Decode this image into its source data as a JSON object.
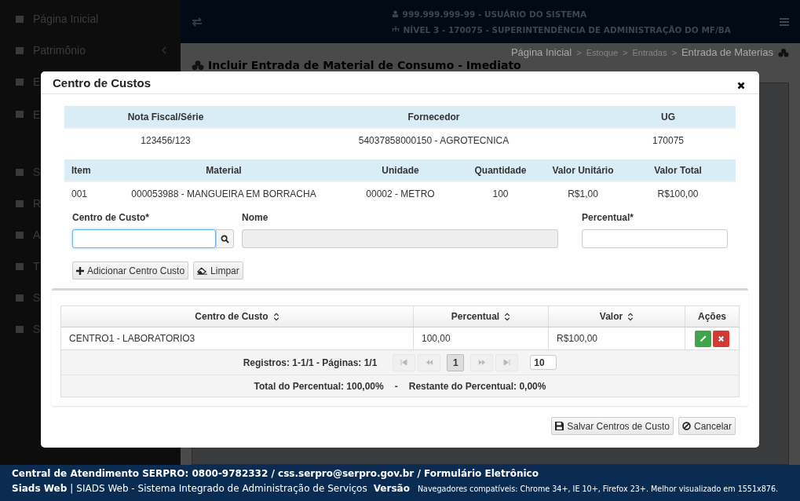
{
  "sidebar": {
    "items": [
      {
        "label": "Página Inicial",
        "has_chevron": false
      },
      {
        "label": "Patrimônio",
        "has_chevron": true
      },
      {
        "label": "E"
      },
      {
        "label": "E"
      },
      {
        "label": "S"
      },
      {
        "label": "R"
      },
      {
        "label": "A"
      },
      {
        "label": "T"
      },
      {
        "label": "S"
      },
      {
        "label": "S"
      }
    ]
  },
  "header": {
    "user": "999.999.999-99 - USUÁRIO DO SISTEMA",
    "level": "NÍVEL 3 - 170075 - SUPERINTENDÊNCIA DE ADMINISTRAÇÃO DO MF/BA"
  },
  "breadcrumb": {
    "separator": ">",
    "items": [
      {
        "label": "Página Inicial",
        "muted": false
      },
      {
        "label": "Estoque",
        "muted": true
      },
      {
        "label": "Entradas",
        "muted": true
      },
      {
        "label": "Entrada de Materias",
        "muted": false
      }
    ]
  },
  "page_title": "Incluir Entrada de Material de Consumo - Imediato",
  "modal": {
    "title": "Centro de Custos",
    "invoice": {
      "columns": [
        "Nota Fiscal/Série",
        "Fornecedor",
        "UG"
      ],
      "row": [
        "123456/123",
        "54037858000150 - AGROTECNICA",
        "170075"
      ]
    },
    "items": {
      "columns": [
        "Item",
        "Material",
        "Unidade",
        "Quantidade",
        "Valor Unitário",
        "Valor Total"
      ],
      "rows": [
        [
          "001",
          "000053988 - MANGUEIRA EM BORRACHA",
          "00002 - METRO",
          "100",
          "R$1,00",
          "R$100,00"
        ]
      ]
    },
    "form": {
      "fields": [
        {
          "kind": "search",
          "label": "Centro de Custo*",
          "focused": true,
          "disabled": false
        },
        {
          "kind": "text",
          "label": "Nome",
          "focused": false,
          "disabled": true
        },
        {
          "kind": "text",
          "label": "Percentual*",
          "focused": false,
          "disabled": false
        }
      ]
    },
    "form_buttons": [
      {
        "kind": "add",
        "label": "Adicionar Centro Custo"
      },
      {
        "kind": "clear",
        "label": "Limpar"
      }
    ],
    "cost_table": {
      "columns": [
        {
          "label": "Centro de Custo",
          "sortable": true
        },
        {
          "label": "Percentual",
          "sortable": true
        },
        {
          "label": "Valor",
          "sortable": true
        },
        {
          "label": "Ações",
          "sortable": false
        }
      ],
      "rows": [
        [
          "CENTRO1 - LABORATORIO3",
          "100,00",
          "R$100,00"
        ]
      ],
      "pagination": {
        "summary": "Registros: 1-1/1 - Páginas: 1/1",
        "nav_disabled": true,
        "pages": [
          {
            "label": "1",
            "selected": true
          }
        ],
        "page_size": "10"
      },
      "totals": {
        "total": "Total do Percentual: 100,00%",
        "separator": "-",
        "remaining": "Restante do Percentual: 0,00%"
      }
    },
    "footer_buttons": [
      {
        "kind": "save",
        "label": "Salvar Centros de Custo"
      },
      {
        "kind": "cancel",
        "label": "Cancelar"
      }
    ]
  },
  "footer": {
    "contact": "Central de Atendimento SERPRO: 0800-9782332 / css.serpro@serpro.gov.br / Formulário Eletrônico",
    "brand": "Siads Web",
    "separator": "|",
    "system": "SIADS Web - Sistema Integrado de Administração de Serviços",
    "version_label": "Versão",
    "browsers": "Navegadores compatíveis: Chrome 34+, IE 10+, Firefox 23+. Melhor visualizado em 1551x876."
  }
}
